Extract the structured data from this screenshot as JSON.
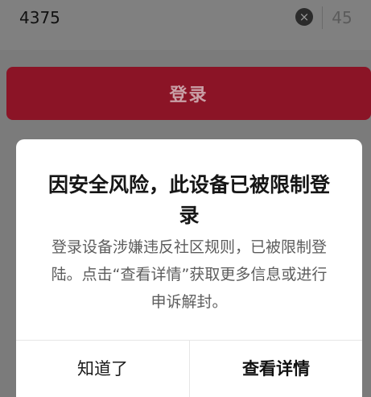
{
  "phone_input": {
    "value": "4375"
  },
  "verify_code": {
    "countdown": "45"
  },
  "login_button": {
    "label": "登录"
  },
  "dialog": {
    "title": "因安全风险，此设备已被限制登录",
    "message": "登录设备涉嫌违反社区规则，已被限制登陆。点击“查看详情”获取更多信息或进行申诉解封。",
    "dismiss_label": "知道了",
    "details_label": "查看详情"
  },
  "icons": {
    "clear": "clear-icon"
  },
  "colors": {
    "login_button": "#8b1426",
    "overlay": "#7b7b7b",
    "dialog_bg": "#ffffff"
  }
}
